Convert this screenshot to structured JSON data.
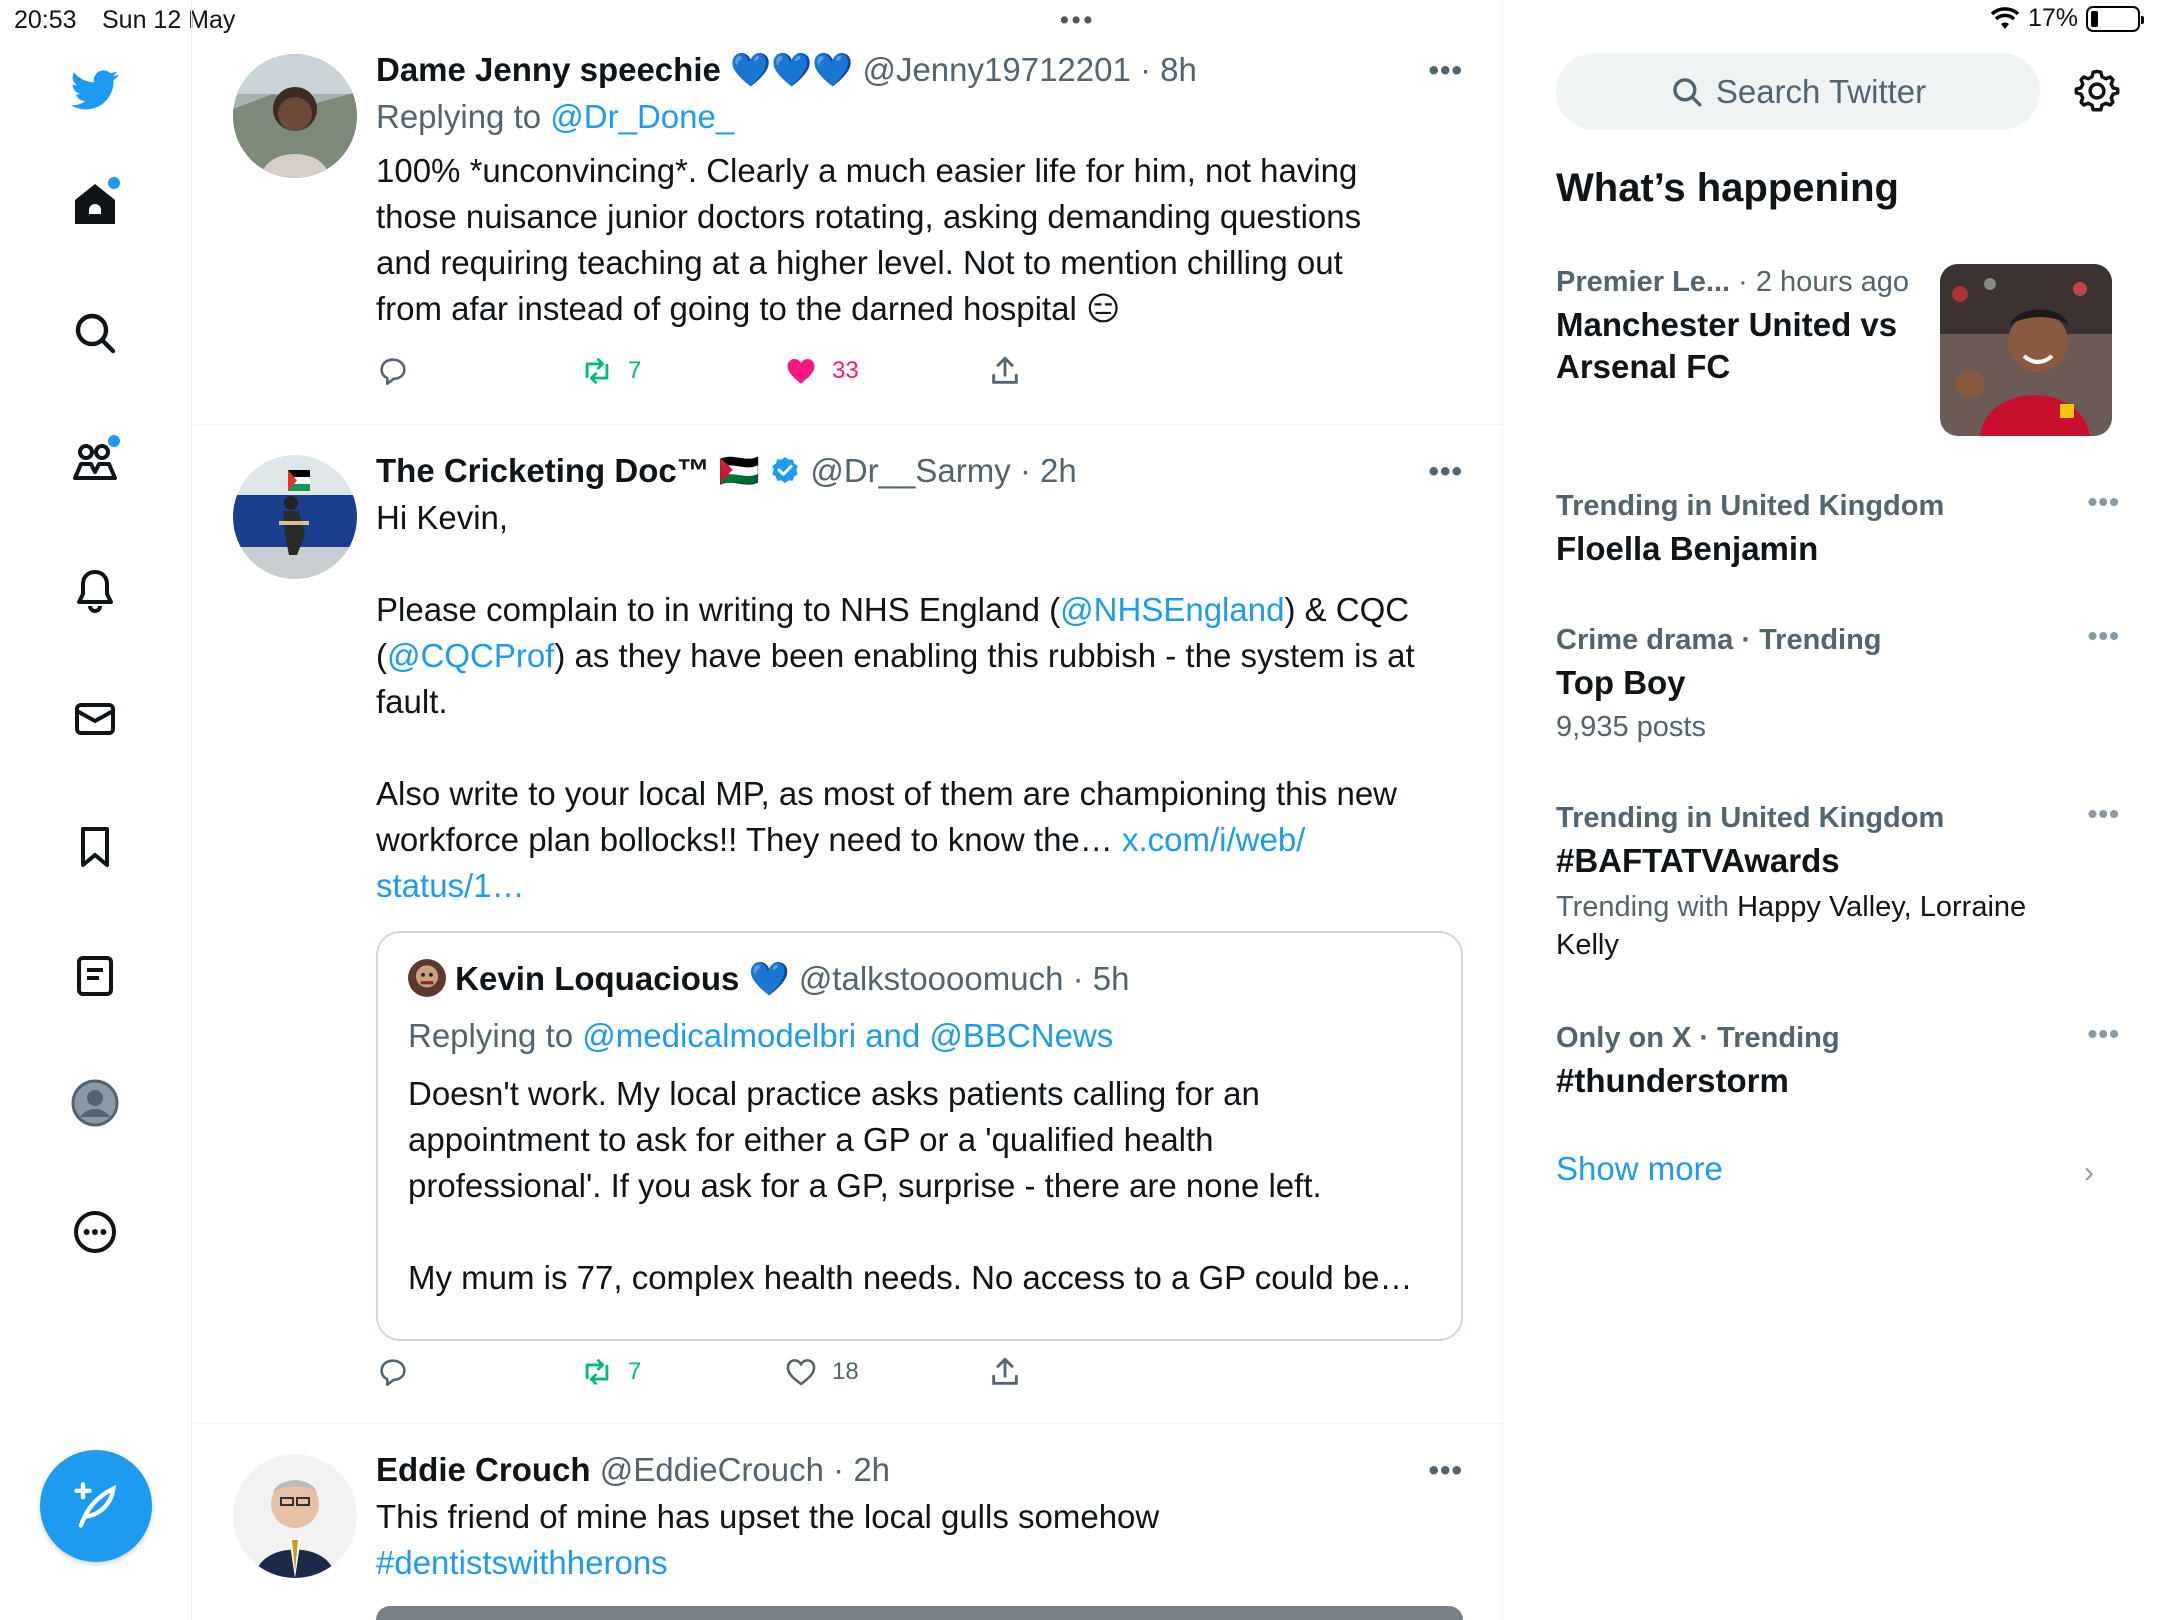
{
  "status_bar": {
    "time": "20:53",
    "date": "Sun 12 May",
    "battery": "17%"
  },
  "tweets": [
    {
      "name": "Dame Jenny speechie 💙💙💙",
      "handle": "@Jenny19712201",
      "time": "· 8h",
      "reply_prefix": "Replying to ",
      "reply_to": "@Dr_Done_",
      "text_lines": [
        "100% *unconvincing*. Clearly a much easier life for him, not having",
        "those nuisance junior doctors rotating, asking demanding questions",
        "and requiring teaching at a higher level. Not to mention  chilling out",
        "from afar instead of going to the darned hospital 😑"
      ],
      "retweets": "7",
      "likes": "33"
    },
    {
      "name": "The Cricketing Doc™ 🇵🇸",
      "handle": "@Dr__Sarmy",
      "time": "· 2h",
      "line1": "Hi Kevin,",
      "p2_a": "Please complain to in writing to NHS England (",
      "p2_link1": "@NHSEngland",
      "p2_b": ") & CQC",
      "p2_c": "(",
      "p2_link2": "@CQCProf",
      "p2_d": ") as they have been enabling this rubbish - the system is at",
      "p2_e": "fault.",
      "p3_a": "Also write to your local MP, as most of them are championing this new",
      "p3_b": "workforce plan bollocks!! They need to know the… ",
      "p3_link_a": "x.com/i/web/",
      "p3_link_b": "status/1…",
      "retweets": "7",
      "likes": "18",
      "quote": {
        "name": "Kevin Loquacious 💙",
        "handle": "@talkstoooomuch",
        "time": "· 5h",
        "reply_prefix": "Replying to ",
        "reply_to": "@medicalmodelbri and @BBCNews",
        "text_lines": [
          "Doesn't work. My local practice asks patients calling for an",
          "appointment to ask for either a GP or a 'qualified health",
          "professional'. If you ask for a GP, surprise - there are none left."
        ],
        "text_last": "My mum is 77, complex health needs. No access to a GP could be…"
      }
    },
    {
      "name": "Eddie Crouch",
      "handle": "@EddieCrouch",
      "time": "· 2h",
      "text": "This friend of mine has upset the local gulls somehow",
      "hashtag": "#dentistswithherons"
    }
  ],
  "sidebar": {
    "search_placeholder": "Search Twitter",
    "heading": "What’s happening",
    "news": {
      "source": "Premier Le...",
      "time": "· 2 hours ago",
      "title_1": "Manchester United vs",
      "title_2": "Arsenal FC"
    },
    "trends": [
      {
        "meta": "Trending in United Kingdom",
        "title": "Floella Benjamin"
      },
      {
        "meta": "Crime drama · Trending",
        "title": "Top Boy",
        "sub": "9,935 posts"
      },
      {
        "meta": "Trending in United Kingdom",
        "title": "#BAFTATVAwards",
        "sub_prefix": "Trending with ",
        "sub_names_1": "Happy Valley, Lorraine",
        "sub_names_2": "Kelly"
      },
      {
        "meta": "Only on X · Trending",
        "title": "#thunderstorm"
      }
    ],
    "show_more": "Show more"
  },
  "colors": {
    "accent": "#1d9bf0",
    "like": "#f91880",
    "retweet": "#00ba7c"
  }
}
